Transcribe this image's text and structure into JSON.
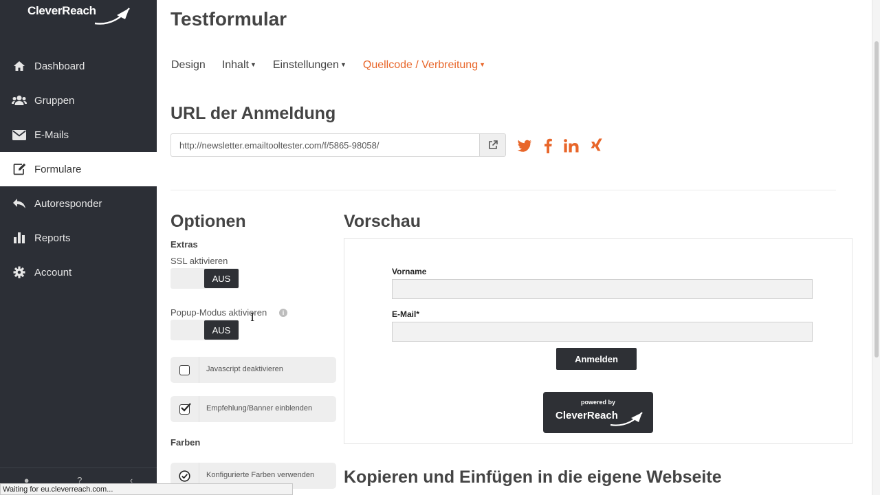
{
  "brand": {
    "logo_text": "CleverReach",
    "accent_color": "#e8662a",
    "sidebar_color": "#2c2f36"
  },
  "sidebar": {
    "items": [
      {
        "label": "Dashboard",
        "icon": "home-icon"
      },
      {
        "label": "Gruppen",
        "icon": "users-icon"
      },
      {
        "label": "E-Mails",
        "icon": "envelope-icon"
      },
      {
        "label": "Formulare",
        "icon": "edit-icon",
        "active": true
      },
      {
        "label": "Autoresponder",
        "icon": "reply-icon"
      },
      {
        "label": "Reports",
        "icon": "bar-chart-icon"
      },
      {
        "label": "Account",
        "icon": "gear-icon"
      }
    ]
  },
  "status_bar": {
    "text": "Waiting for eu.cleverreach.com..."
  },
  "header": {
    "title": "Testformular"
  },
  "tabs": [
    {
      "label": "Design"
    },
    {
      "label": "Inhalt"
    },
    {
      "label": "Einstellungen"
    },
    {
      "label": "Quellcode / Verbreitung",
      "active": true
    }
  ],
  "url_section": {
    "title": "URL der Anmeldung",
    "url": "http://newsletter.emailtooltester.com/f/5865-98058/",
    "share_icons": [
      "twitter-icon",
      "facebook-icon",
      "linkedin-icon",
      "xing-icon"
    ]
  },
  "options": {
    "title": "Optionen",
    "extras_heading": "Extras",
    "ssl_label": "SSL aktivieren",
    "ssl_toggle": "AUS",
    "popup_label": "Popup-Modus aktivieren",
    "popup_toggle": "AUS",
    "js_label": "Javascript deaktivieren",
    "js_checked": false,
    "banner_label": "Empfehlung/Banner einblenden",
    "banner_checked": true,
    "colors_heading": "Farben",
    "colors_label": "Konfigurierte Farben verwenden"
  },
  "preview": {
    "title": "Vorschau",
    "field1_label": "Vorname",
    "field2_label": "E-Mail*",
    "submit_label": "Anmelden",
    "badge_top": "powered by",
    "badge_name": "CleverReach"
  },
  "copy_section": {
    "title": "Kopieren und Einfügen in die eigene Webseite"
  }
}
